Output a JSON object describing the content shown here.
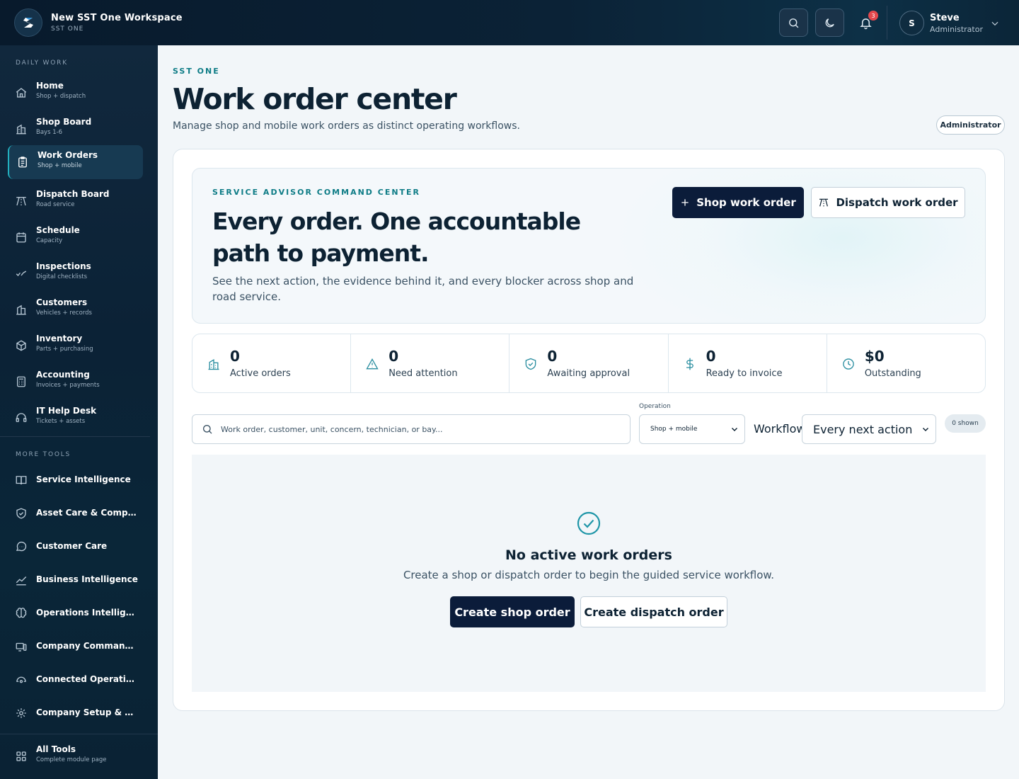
{
  "brand": {
    "title": "New SST One Workspace",
    "subtitle": "SST ONE"
  },
  "topbar": {
    "notifications_count": "3",
    "user": {
      "initial": "S",
      "name": "Steve",
      "role": "Administrator"
    }
  },
  "sidebar": {
    "section_daily": "DAILY WORK",
    "section_more": "MORE TOOLS",
    "items": [
      {
        "label": "Home",
        "sub": "Shop + dispatch",
        "icon": "home-icon"
      },
      {
        "label": "Shop Board",
        "sub": "Bays 1-6",
        "icon": "building-icon"
      },
      {
        "label": "Work Orders",
        "sub": "Shop + mobile",
        "icon": "clipboard-icon"
      },
      {
        "label": "Dispatch Board",
        "sub": "Road service",
        "icon": "road-icon"
      },
      {
        "label": "Schedule",
        "sub": "Capacity",
        "icon": "calendar-icon"
      },
      {
        "label": "Inspections",
        "sub": "Digital checklists",
        "icon": "checklist-icon"
      },
      {
        "label": "Customers",
        "sub": "Vehicles + records",
        "icon": "building-icon"
      },
      {
        "label": "Inventory",
        "sub": "Parts + purchasing",
        "icon": "box-icon"
      },
      {
        "label": "Accounting",
        "sub": "Invoices + payments",
        "icon": "calculator-icon"
      },
      {
        "label": "IT Help Desk",
        "sub": "Tickets + assets",
        "icon": "headset-icon"
      }
    ],
    "tools": [
      {
        "label": "Service Intelligence",
        "icon": "book-icon"
      },
      {
        "label": "Asset Care & Compliance",
        "icon": "shield-icon"
      },
      {
        "label": "Customer Care",
        "icon": "chat-icon"
      },
      {
        "label": "Business Intelligence",
        "icon": "chart-icon"
      },
      {
        "label": "Operations Intelligence",
        "icon": "brain-icon"
      },
      {
        "label": "Company Command Center",
        "icon": "devices-icon"
      },
      {
        "label": "Connected Operations",
        "icon": "link-icon"
      },
      {
        "label": "Company Setup & Subscription",
        "icon": "gear-icon"
      }
    ],
    "all_tools": {
      "label": "All Tools",
      "sub": "Complete module page"
    }
  },
  "page": {
    "eyebrow": "SST ONE",
    "title": "Work order center",
    "description": "Manage shop and mobile work orders as distinct operating workflows.",
    "role_badge": "Administrator"
  },
  "hero": {
    "eyebrow": "SERVICE ADVISOR COMMAND CENTER",
    "title": "Every order. One accountable path to payment.",
    "description": "See the next action, the evidence behind it, and every blocker across shop and road service.",
    "shop_button": "Shop work order",
    "dispatch_button": "Dispatch work order"
  },
  "stats": [
    {
      "value": "0",
      "label": "Active orders",
      "icon": "building-icon"
    },
    {
      "value": "0",
      "label": "Need attention",
      "icon": "warning-icon"
    },
    {
      "value": "0",
      "label": "Awaiting approval",
      "icon": "shield-check-icon"
    },
    {
      "value": "0",
      "label": "Ready to invoice",
      "icon": "dollar-icon"
    },
    {
      "value": "$0",
      "label": "Outstanding",
      "icon": "clock-icon"
    }
  ],
  "filters": {
    "search_placeholder": "Work order, customer, unit, concern, technician, or bay...",
    "operation_label": "Operation",
    "operation_value": "Shop + mobile",
    "workflow_label": "Workflow",
    "workflow_value": "Every next action",
    "shown_count": "0 shown"
  },
  "empty_state": {
    "title": "No active work orders",
    "description": "Create a shop or dispatch order to begin the guided service workflow.",
    "create_shop": "Create shop order",
    "create_dispatch": "Create dispatch order"
  },
  "colors": {
    "accent": "#0e7c86",
    "primary_button": "#0b1c3a",
    "badge": "#e5484d",
    "sidebar": "#0b2236"
  }
}
